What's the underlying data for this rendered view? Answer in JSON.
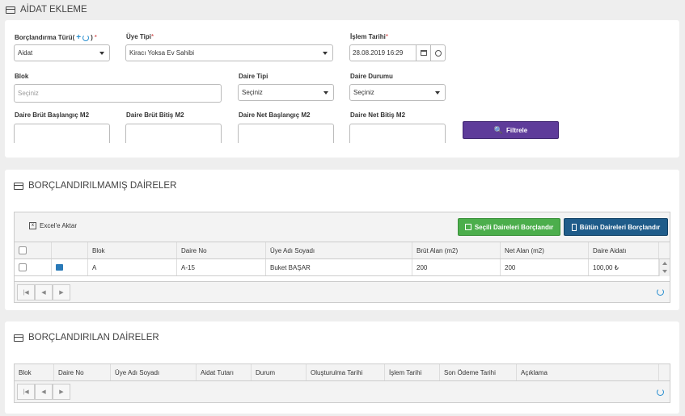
{
  "aidat": {
    "title": "AİDAT EKLEME",
    "borc_turu": {
      "label": "Borçlandırma Türü(",
      "close": ")",
      "value": "Aidat"
    },
    "uye_tipi": {
      "label": "Üye Tipi",
      "value": "Kiracı Yoksa Ev Sahibi"
    },
    "islem_tarihi": {
      "label": "İşlem Tarihi",
      "value": "28.08.2019 16:29"
    },
    "blok": {
      "label": "Blok",
      "placeholder": "Seçiniz"
    },
    "daire_tipi": {
      "label": "Daire Tipi",
      "value": "Seçiniz"
    },
    "daire_durumu": {
      "label": "Daire Durumu",
      "value": "Seçiniz"
    },
    "brut_bas": {
      "label": "Daire Brüt Başlangıç M2"
    },
    "brut_bit": {
      "label": "Daire Brüt Bitiş M2"
    },
    "net_bas": {
      "label": "Daire Net Başlangıç M2"
    },
    "net_bit": {
      "label": "Daire Net Bitiş M2"
    },
    "filter_button": "Filtrele",
    "required_mark": "*"
  },
  "unpaid": {
    "title": "BORÇLANDIRILMAMIŞ DAİRELER",
    "excel_button": "Excel'e Aktar",
    "selected_button": "Seçili Daireleri Borçlandır",
    "all_button": "Bütün Daireleri Borçlandır",
    "columns": [
      "Blok",
      "Daire No",
      "Üye Adı Soyadı",
      "Brüt Alan (m2)",
      "Net Alan (m2)",
      "Daire Aidatı"
    ],
    "rows": [
      {
        "blok": "A",
        "daire_no": "A-15",
        "uye": "Buket BAŞAR",
        "brut": "200",
        "net": "200",
        "aidat": "100,00 ₺"
      }
    ]
  },
  "paid": {
    "title": "BORÇLANDIRILAN DAİRELER",
    "columns": [
      "Blok",
      "Daire No",
      "Üye Adı Soyadı",
      "Aidat Tutarı",
      "Durum",
      "Oluşturulma Tarihi",
      "İşlem Tarihi",
      "Son Ödeme Tarihi",
      "Açıklama"
    ]
  },
  "colors": {
    "purple": "#5e3c9a",
    "green": "#4cae4c",
    "navy": "#1f5c8a",
    "accent": "#2a8fd0"
  }
}
